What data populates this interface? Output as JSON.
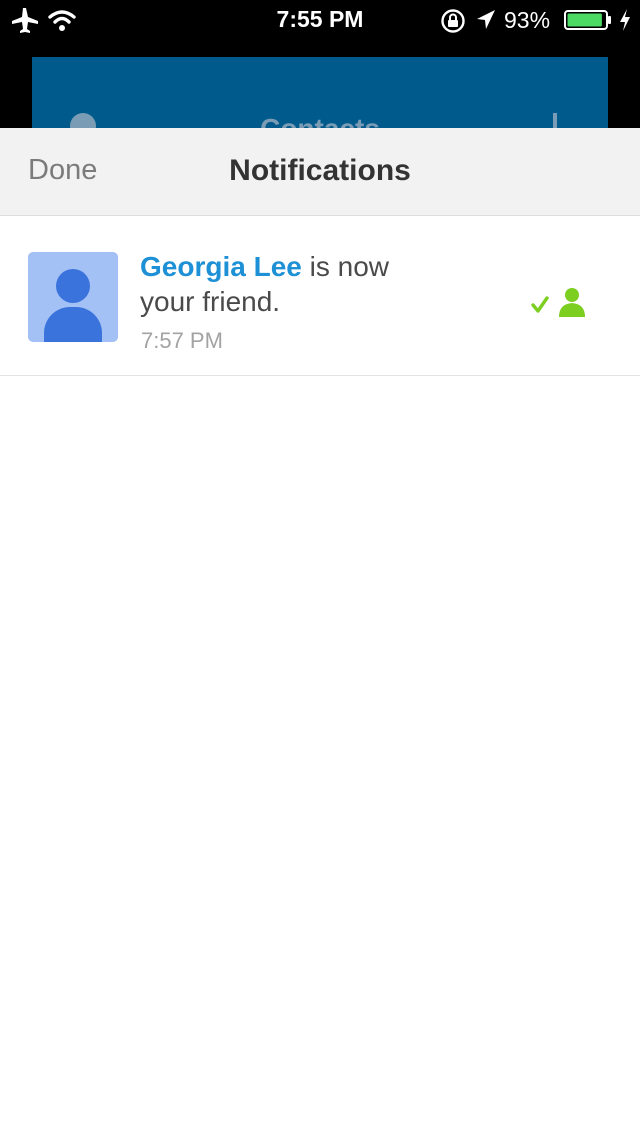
{
  "status_bar": {
    "time": "7:55 PM",
    "battery_percent": "93%",
    "icons": [
      "airplane-icon",
      "wifi-icon",
      "rotation-lock-icon",
      "location-icon",
      "battery-icon",
      "charging-icon"
    ],
    "battery_level": 0.93
  },
  "background_screen": {
    "title": "Contacts",
    "color": "#005b8c"
  },
  "navbar": {
    "done_label": "Done",
    "title": "Notifications"
  },
  "notifications": [
    {
      "name": "Georgia Lee",
      "message": " is now your friend.",
      "time": "7:57 PM",
      "status_icon": "friend-added-icon"
    }
  ],
  "colors": {
    "accent": "#1e90d6",
    "friend_green": "#7ccf21",
    "battery_green": "#4cd964"
  }
}
